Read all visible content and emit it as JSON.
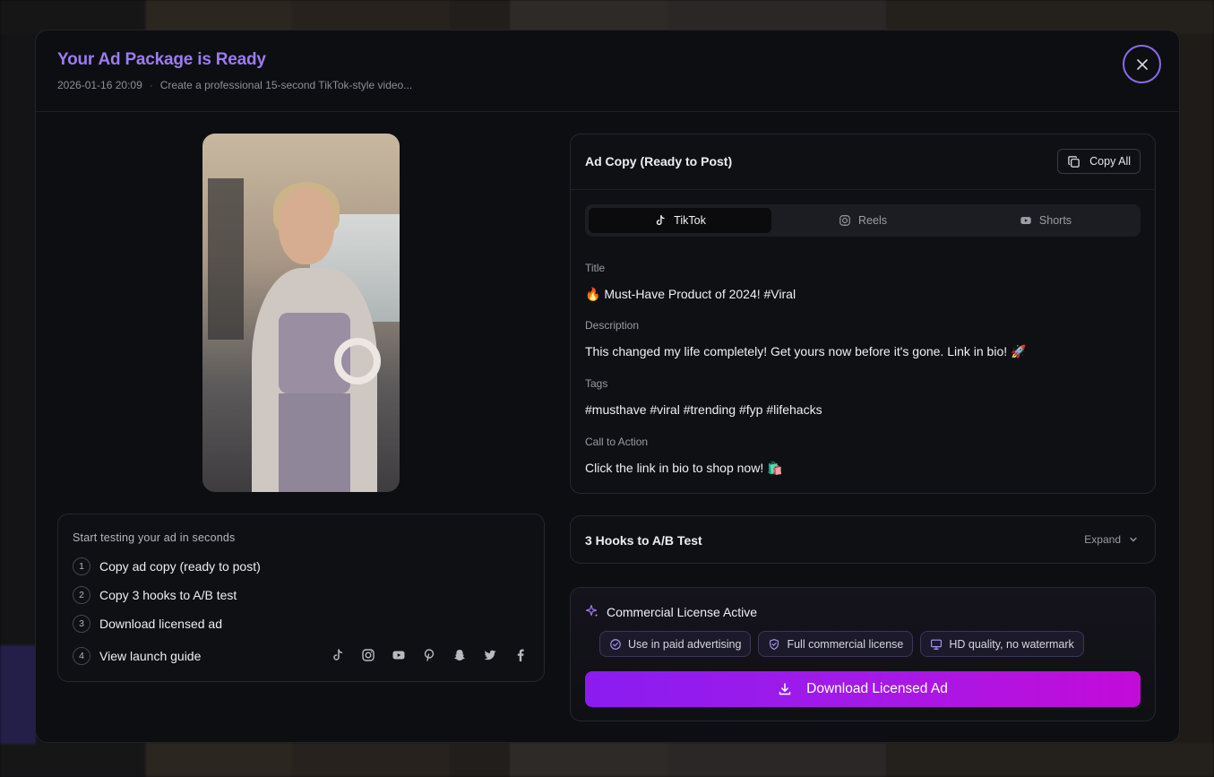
{
  "header": {
    "title": "Your Ad Package is Ready",
    "date": "2026-01-16 20:09",
    "separator": "·",
    "prompt_preview": "Create a professional 15-second TikTok-style video..."
  },
  "steps": {
    "heading": "Start testing your ad in seconds",
    "items": [
      {
        "num": "1",
        "label": "Copy ad copy (ready to post)"
      },
      {
        "num": "2",
        "label": "Copy 3 hooks to A/B test"
      },
      {
        "num": "3",
        "label": "Download licensed ad"
      },
      {
        "num": "4",
        "label": "View launch guide"
      }
    ],
    "social_icons": [
      "tiktok-icon",
      "instagram-icon",
      "youtube-icon",
      "pinterest-icon",
      "snapchat-icon",
      "twitter-icon",
      "facebook-icon"
    ]
  },
  "ad_copy": {
    "title": "Ad Copy (Ready to Post)",
    "copy_all_label": "Copy All",
    "tabs": [
      {
        "label": "TikTok",
        "icon": "tiktok-icon",
        "active": true
      },
      {
        "label": "Reels",
        "icon": "instagram-icon",
        "active": false
      },
      {
        "label": "Shorts",
        "icon": "youtube-icon",
        "active": false
      }
    ],
    "fields": {
      "title_label": "Title",
      "title_value": "🔥 Must-Have Product of 2024! #Viral",
      "description_label": "Description",
      "description_value": "This changed my life completely! Get yours now before it's gone. Link in bio! 🚀",
      "tags_label": "Tags",
      "tags_value": "#musthave #viral #trending #fyp #lifehacks",
      "cta_label": "Call to Action",
      "cta_value": "Click the link in bio to shop now! 🛍️"
    }
  },
  "hooks": {
    "title": "3 Hooks to A/B Test",
    "expand_label": "Expand"
  },
  "license": {
    "title": "Commercial License Active",
    "chips": [
      {
        "label": "Use in paid advertising",
        "icon": "check-circle-icon"
      },
      {
        "label": "Full commercial license",
        "icon": "shield-icon"
      },
      {
        "label": "HD quality, no watermark",
        "icon": "monitor-icon"
      }
    ],
    "download_label": "Download Licensed Ad"
  },
  "colors": {
    "title_accent": "#9d7bf0",
    "close_ring": "#8a6ae8",
    "download_gradient_start": "#8a1cf0",
    "download_gradient_end": "#c30bd8"
  }
}
